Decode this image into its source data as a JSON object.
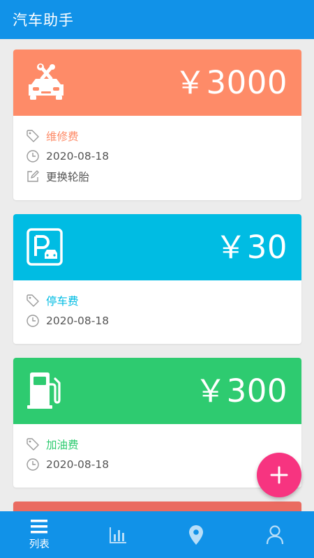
{
  "app": {
    "title": "汽车助手"
  },
  "colors": {
    "primary": "#1192e8",
    "repair": "#fe8b68",
    "parking": "#00bce3",
    "fuel": "#2ecb70",
    "partial": "#ea6b61",
    "fab": "#f73480"
  },
  "cards": [
    {
      "icon": "car-repair-icon",
      "amount": "￥3000",
      "category": "维修费",
      "date": "2020-08-18",
      "note": "更换轮胎"
    },
    {
      "icon": "parking-icon",
      "amount": "￥30",
      "category": "停车费",
      "date": "2020-08-18"
    },
    {
      "icon": "fuel-pump-icon",
      "amount": "￥300",
      "category": "加油费",
      "date": "2020-08-18"
    }
  ],
  "fab": {
    "icon": "plus-icon"
  },
  "bottom_nav": [
    {
      "icon": "list-icon",
      "label": "列表",
      "active": true
    },
    {
      "icon": "bar-chart-icon",
      "active": false
    },
    {
      "icon": "location-icon",
      "active": false
    },
    {
      "icon": "user-icon",
      "active": false
    }
  ]
}
